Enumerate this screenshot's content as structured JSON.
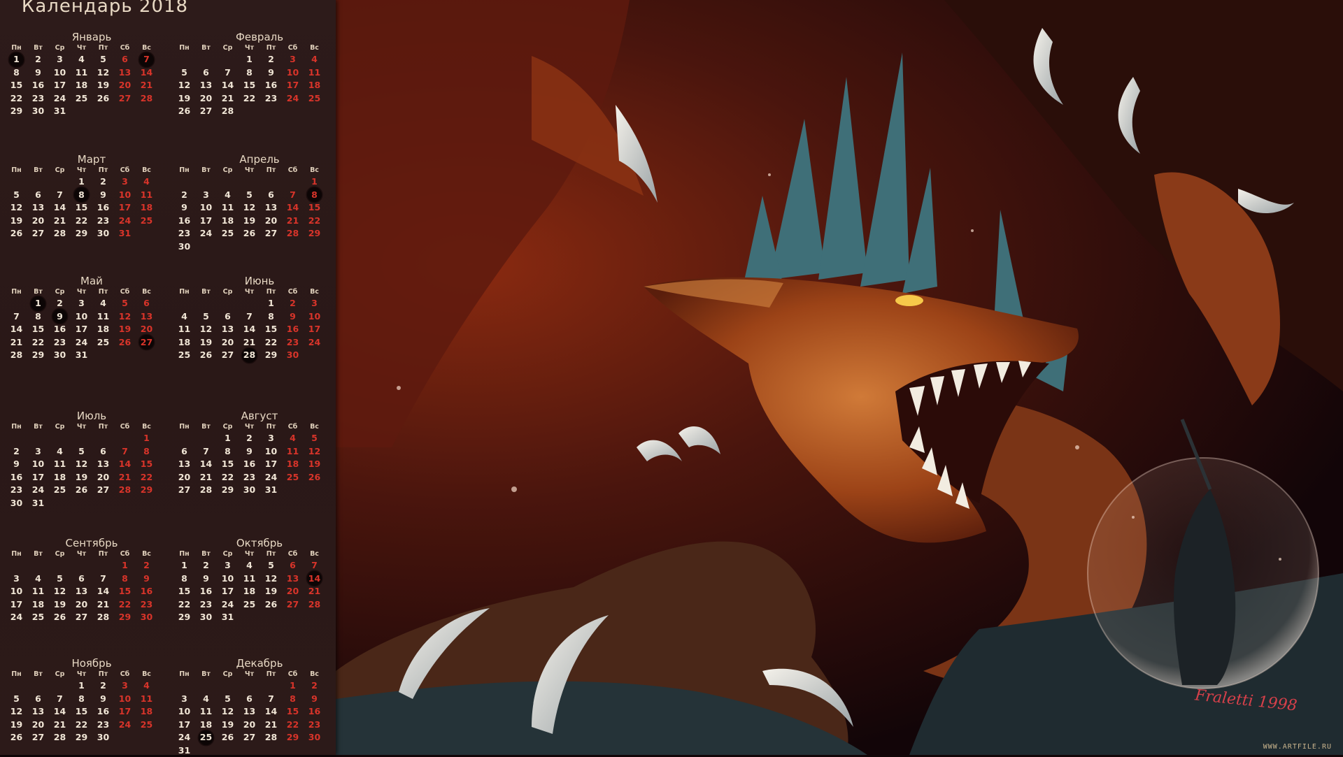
{
  "calendar": {
    "title": "Календарь 2018",
    "weekdays": [
      "Пн",
      "Вт",
      "Ср",
      "Чт",
      "Пт",
      "Сб",
      "Вс"
    ],
    "months": [
      {
        "name": "Январь",
        "offset": 0,
        "days": 31,
        "hl": [
          1,
          7
        ]
      },
      {
        "name": "Февраль",
        "offset": 3,
        "days": 28,
        "hl": []
      },
      {
        "name": "Март",
        "offset": 3,
        "days": 31,
        "hl": [
          8
        ]
      },
      {
        "name": "Апрель",
        "offset": 6,
        "days": 30,
        "hl": [
          8
        ]
      },
      {
        "name": "Май",
        "offset": 1,
        "days": 31,
        "hl": [
          1,
          9,
          27
        ]
      },
      {
        "name": "Июнь",
        "offset": 4,
        "days": 30,
        "hl": [
          28
        ]
      },
      {
        "name": "Июль",
        "offset": 6,
        "days": 31,
        "hl": []
      },
      {
        "name": "Август",
        "offset": 2,
        "days": 31,
        "hl": []
      },
      {
        "name": "Сентябрь",
        "offset": 5,
        "days": 30,
        "hl": []
      },
      {
        "name": "Октябрь",
        "offset": 0,
        "days": 31,
        "hl": [
          14
        ]
      },
      {
        "name": "Ноябрь",
        "offset": 3,
        "days": 30,
        "hl": []
      },
      {
        "name": "Декабрь",
        "offset": 5,
        "days": 31,
        "hl": [
          25
        ]
      }
    ]
  },
  "signature": "Fraletti 1998",
  "watermark": "WWW.ARTFILE.RU",
  "colors": {
    "panel": "#2d1b1a",
    "text": "#f1e6d6",
    "weekend": "#d8342a",
    "highlight_circle": "#0c0505"
  }
}
